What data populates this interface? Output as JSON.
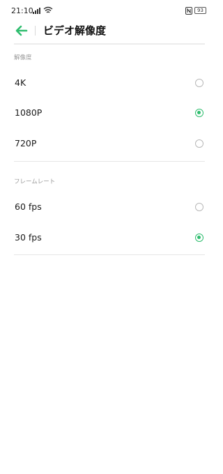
{
  "status": {
    "time": "21:10",
    "battery": "93"
  },
  "header": {
    "title": "ビデオ解像度"
  },
  "resolution": {
    "label": "解像度",
    "options": [
      {
        "label": "4K",
        "selected": false
      },
      {
        "label": "1080P",
        "selected": true
      },
      {
        "label": "720P",
        "selected": false
      }
    ]
  },
  "framerate": {
    "label": "フレームレート",
    "options": [
      {
        "label": "60 fps",
        "selected": false
      },
      {
        "label": "30 fps",
        "selected": true
      }
    ]
  },
  "colors": {
    "accent": "#2ebd6e"
  }
}
